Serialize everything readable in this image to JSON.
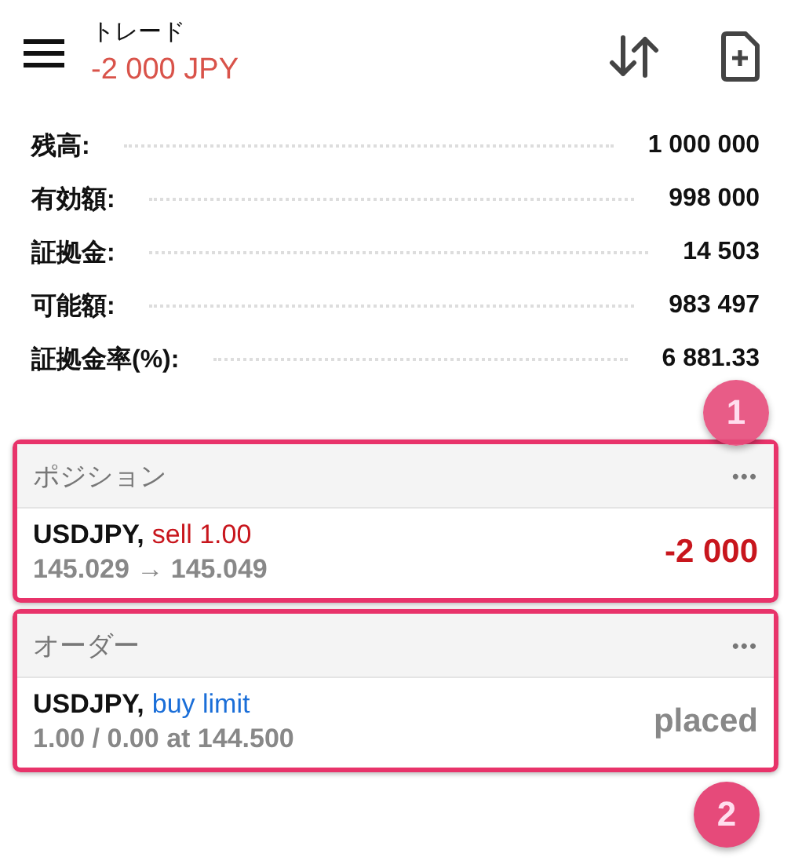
{
  "header": {
    "title": "トレード",
    "balance": "-2 000 JPY"
  },
  "summary": {
    "items": [
      {
        "label": "残高:",
        "value": "1 000 000"
      },
      {
        "label": "有効額:",
        "value": "998 000"
      },
      {
        "label": "証拠金:",
        "value": "14 503"
      },
      {
        "label": "可能額:",
        "value": "983 497"
      },
      {
        "label": "証拠金率(%):",
        "value": "6 881.33"
      }
    ],
    "callout": "1"
  },
  "sections": [
    {
      "title": "ポジション",
      "more": "•••",
      "highlighted": true,
      "rows": [
        {
          "symbol": "USDJPY,",
          "action": {
            "text": "sell 1.00",
            "color": "#c8161d"
          },
          "detail": "145.029 → 145.049",
          "result": {
            "text": "-2 000",
            "color": "#c8161d"
          }
        }
      ]
    },
    {
      "title": "オーダー",
      "more": "•••",
      "highlighted": true,
      "rows": [
        {
          "symbol": "USDJPY,",
          "action": {
            "text": "buy limit",
            "color": "#1a6ed8"
          },
          "detail": "1.00 / 0.00 at 144.500",
          "result": {
            "text": "placed",
            "color": "#888888"
          }
        }
      ],
      "callout": "2"
    }
  ]
}
